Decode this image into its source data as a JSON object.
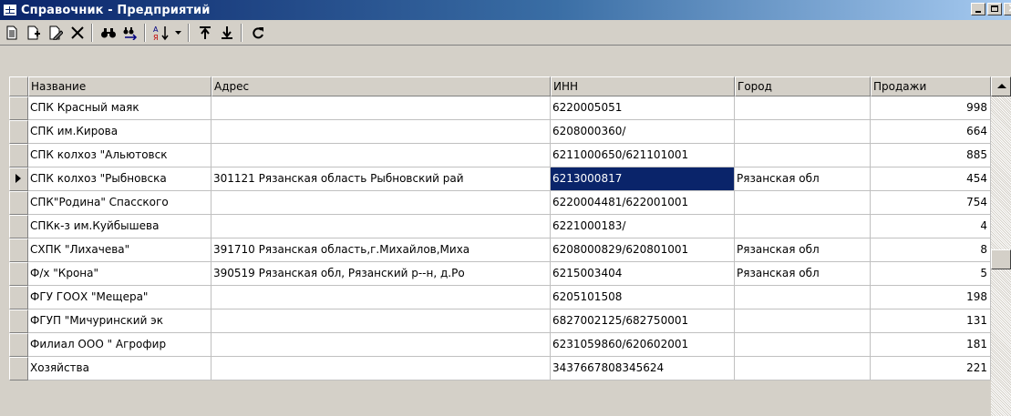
{
  "window": {
    "title": "Справочник - Предприятий"
  },
  "toolbar": {
    "buttons": [
      {
        "name": "new-record-icon"
      },
      {
        "name": "copy-record-icon"
      },
      {
        "name": "edit-record-icon"
      },
      {
        "name": "delete-icon"
      },
      {
        "name": "find-icon"
      },
      {
        "name": "find-next-icon"
      },
      {
        "name": "sort-az-icon"
      },
      {
        "name": "dropdown-icon"
      },
      {
        "name": "move-top-icon"
      },
      {
        "name": "move-bottom-icon"
      },
      {
        "name": "refresh-icon"
      }
    ]
  },
  "table": {
    "columns": [
      "Название",
      "Адрес",
      "ИНН",
      "Город",
      "Продажи"
    ],
    "selected_row_index": 3,
    "rows": [
      {
        "name": "СПК Красный маяк",
        "address": "",
        "inn": "6220005051",
        "city": "",
        "sales": "998"
      },
      {
        "name": "СПК им.Кирова",
        "address": "",
        "inn": "6208000360/",
        "city": "",
        "sales": "664"
      },
      {
        "name": "СПК колхоз \"Альютовск",
        "address": "",
        "inn": "6211000650/621101001",
        "city": "",
        "sales": "885"
      },
      {
        "name": "СПК колхоз \"Рыбновска",
        "address": "301121 Рязанская область Рыбновский рай",
        "inn": "6213000817",
        "city": "Рязанская обл",
        "sales": "454"
      },
      {
        "name": "СПК\"Родина\" Спасского",
        "address": "",
        "inn": "6220004481/622001001",
        "city": "",
        "sales": "754"
      },
      {
        "name": "СПКк-з им.Куйбышева",
        "address": "",
        "inn": "6221000183/",
        "city": "",
        "sales": "4"
      },
      {
        "name": "СХПК \"Лихачева\"",
        "address": "391710 Рязанская область,г.Михайлов,Миха",
        "inn": "6208000829/620801001",
        "city": "Рязанская обл",
        "sales": "8"
      },
      {
        "name": "Ф/х \"Крона\"",
        "address": "390519 Рязанская обл, Рязанский р--н, д.Ро",
        "inn": "6215003404",
        "city": "Рязанская обл",
        "sales": "5"
      },
      {
        "name": "ФГУ ГООХ \"Мещера\"",
        "address": "",
        "inn": "6205101508",
        "city": "",
        "sales": "198"
      },
      {
        "name": "ФГУП \"Мичуринский эк",
        "address": "",
        "inn": "6827002125/682750001",
        "city": "",
        "sales": "131"
      },
      {
        "name": "Филиал ООО \" Агрофир",
        "address": "",
        "inn": "6231059860/620602001",
        "city": "",
        "sales": "181"
      },
      {
        "name": "Хозяйства",
        "address": "",
        "inn": "3437667808345624",
        "city": "",
        "sales": "221"
      }
    ]
  },
  "colors": {
    "title_bar": "#0a246a",
    "selection": "#0a246a",
    "face": "#d4d0c8"
  }
}
